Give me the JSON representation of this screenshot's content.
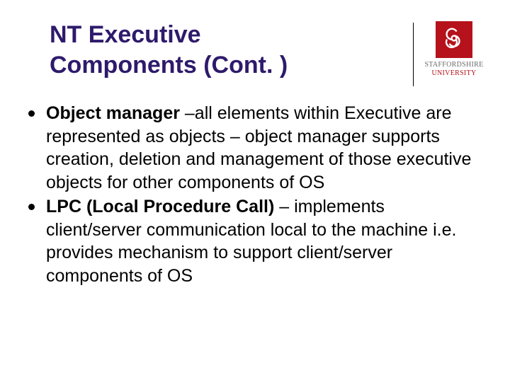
{
  "title": {
    "line1": "NT Executive",
    "line2": "Components (Cont. )"
  },
  "logo": {
    "brand": "STAFFORDSHIRE",
    "sub": "UNIVERSITY",
    "icon": "biohazard-icon"
  },
  "bullets": [
    {
      "bold": "Object manager ",
      "rest": "–all elements within Executive are represented as objects – object manager supports creation, deletion and management of those executive objects for other components of OS"
    },
    {
      "bold": "LPC (Local Procedure Call) ",
      "rest": "– implements client/server communication local to the machine i.e. provides mechanism to support client/server components of OS"
    }
  ]
}
